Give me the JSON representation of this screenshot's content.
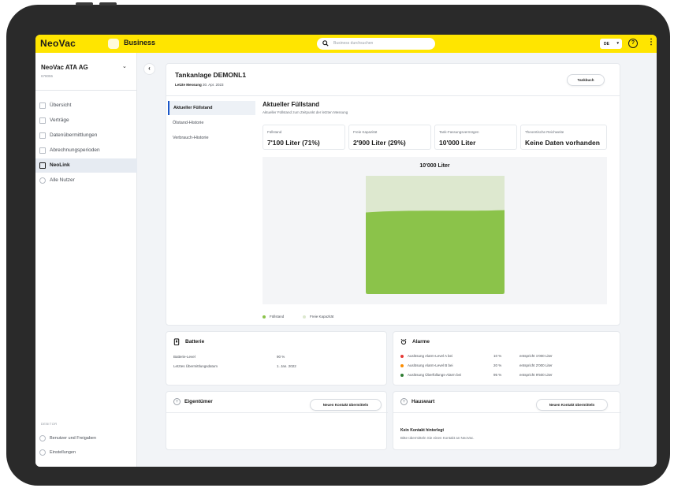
{
  "app": {
    "logo": "NeoVac",
    "product": "Business",
    "search_placeholder": "Business durchsuchen",
    "language": "DE",
    "colors": {
      "brand_yellow": "#ffe500",
      "fill_green": "#8bc34a",
      "free_green": "#dde8cf",
      "accent_blue": "#1a56c9"
    }
  },
  "sidebar": {
    "org_name": "NeoVac ATA AG",
    "org_id": "678055",
    "items": [
      {
        "label": "Übersicht",
        "icon": "grid-icon"
      },
      {
        "label": "Verträge",
        "icon": "document-icon"
      },
      {
        "label": "Datenübermittlungen",
        "icon": "file-transfer-icon"
      },
      {
        "label": "Abrechnungsperioden",
        "icon": "calendar-icon"
      },
      {
        "label": "NeoLink",
        "icon": "book-icon",
        "active": true
      },
      {
        "label": "Alle Nutzer",
        "icon": "users-icon"
      }
    ],
    "section_label": "DEBITOR",
    "footer_items": [
      {
        "label": "Benutzer und Freigaben",
        "icon": "users-icon"
      },
      {
        "label": "Einstellungen",
        "icon": "gear-icon"
      }
    ]
  },
  "header": {
    "title": "Tankanlage DEMONL1",
    "last_measure_label": "Letzte Messung",
    "last_measure_date": "30. Apr. 2023",
    "tankbuch_button": "Tankbuch"
  },
  "subnav": [
    "Aktueller Füllstand",
    "Ölstand-Historie",
    "Verbrauch-Historie"
  ],
  "fill": {
    "title": "Aktueller Füllstand",
    "subtitle": "Aktueller Füllstand zum Zeitpunkt der letzten Messung",
    "stats": [
      {
        "label": "Füllstand",
        "value": "7'100 Liter (71%)"
      },
      {
        "label": "Freie Kapazität",
        "value": "2'900 Liter (29%)"
      },
      {
        "label": "Tank-Fassungsvermögen",
        "value": "10'000 Liter"
      },
      {
        "label": "Theoretische Reichweite",
        "value": "Keine Daten vorhanden"
      }
    ],
    "tank_capacity_label": "10'000 Liter",
    "fill_fraction": 0.71,
    "legend": [
      "Füllstand",
      "Freie Kapazität"
    ]
  },
  "battery": {
    "title": "Batterie",
    "rows": [
      {
        "k": "Batterie-Level",
        "v": "90 %"
      },
      {
        "k": "Letztes Übermittlungsdatum",
        "v": "1. Jan. 2022"
      }
    ]
  },
  "alarms": {
    "title": "Alarme",
    "rows": [
      {
        "label": "Auslösung Alarm-Level A bei",
        "pct": "10 %",
        "eq": "entspricht 1'000 Liter",
        "color": "#e53935"
      },
      {
        "label": "Auslösung Alarm-Level B bei",
        "pct": "20 %",
        "eq": "entspricht 2'000 Liter",
        "color": "#fb8c00"
      },
      {
        "label": "Auslösung Überfüllungs-Alarm bei",
        "pct": "95 %",
        "eq": "entspricht 9'500 Liter",
        "color": "#2e7d32"
      }
    ]
  },
  "owner": {
    "title": "Eigentümer",
    "button": "Neuen Kontakt übermitteln"
  },
  "janitor": {
    "title": "Hauswart",
    "button": "Neuen Kontakt übermitteln",
    "empty_title": "Kein Kontakt hinterlegt",
    "empty_sub": "Bitte übermitteln Sie einen Kontakt an NeoVac."
  }
}
